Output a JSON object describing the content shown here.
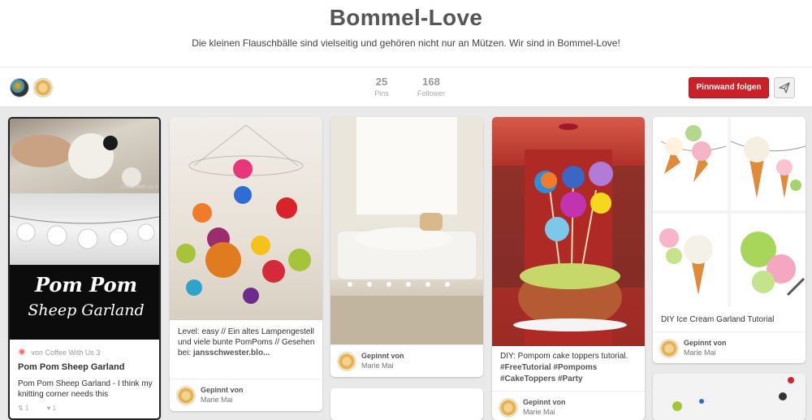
{
  "board": {
    "title": "Bommel-Love",
    "description": "Die kleinen Flauschbälle sind vielseitig und gehören nicht nur an Mützen. Wir sind in Bommel-Love!"
  },
  "stats": {
    "pins_count": "25",
    "pins_label": "Pins",
    "followers_count": "168",
    "followers_label": "Follower"
  },
  "actions": {
    "follow_label": "Pinnwand folgen",
    "send_icon": "paper-plane-icon"
  },
  "pins": [
    {
      "image_text_1": "Pom Pom",
      "image_text_2": "Sheep Garland",
      "watermark": "Coffee With Us 3",
      "via_prefix": "von",
      "via_name": "Coffee With Us 3",
      "title": "Pom Pom Sheep Garland",
      "description": "Pom Pom Sheep Garland - I think my knitting corner needs this",
      "repins": "1",
      "likes": "1"
    },
    {
      "description": "Level: easy // Ein altes Lampengestell und viele bunte PomPoms // Gesehen bei:",
      "link": "jansschwester.blo...",
      "pinned_label": "Gepinnt von",
      "pinner": "Marie Mai"
    },
    {
      "pinned_label": "Gepinnt von",
      "pinner": "Marie Mai"
    },
    {
      "description": "DIY: Pompom cake toppers tutorial.",
      "tags": "#FreeTutorial #Pompoms #CakeToppers #Party",
      "pinned_label": "Gepinnt von",
      "pinner": "Marie Mai"
    },
    {
      "title": "DIY Ice Cream Garland Tutorial",
      "pinned_label": "Gepinnt von",
      "pinner": "Marie Mai"
    }
  ],
  "colors": {
    "brand_red": "#cb2027",
    "background": "#e9e9e9"
  }
}
